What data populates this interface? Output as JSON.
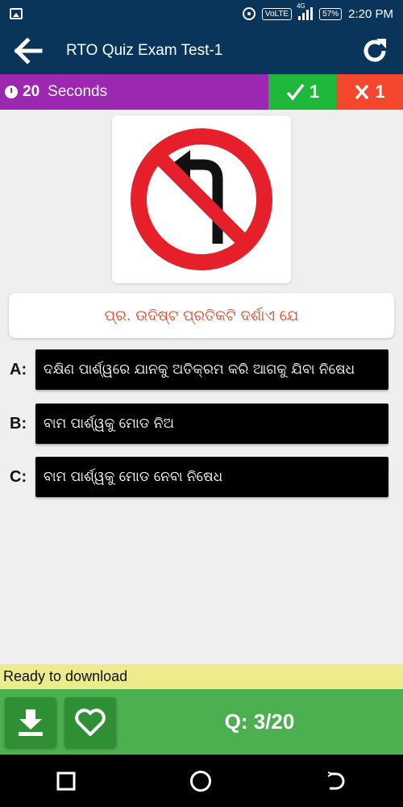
{
  "status_bar": {
    "volte": "VoLTE",
    "network": "4G",
    "battery": "57%",
    "time": "2:20 PM"
  },
  "app_bar": {
    "title": "RTO Quiz Exam Test-1",
    "back_icon": "arrow-left-icon",
    "refresh_icon": "refresh-icon"
  },
  "score": {
    "seconds": "20",
    "seconds_label": "Seconds",
    "correct": "1",
    "wrong": "1",
    "colors": {
      "timer": "#9c27b0",
      "correct": "#1fb83a",
      "wrong": "#f4472e"
    }
  },
  "question": {
    "sign_icon": "no-left-turn-sign-icon",
    "text": "ପ୍ର. ଉଦିଷ୍ଟ ପ୍ରତିକଟି ଦର୍ଶାଏ ଯେ"
  },
  "options": [
    {
      "letter": "A:",
      "text": "ଦକ୍ଷିଣ ପାର୍ଶ୍ୱରେ ଯାନକୁ ଅତିକ୍ରମ କରି ଆଗକୁ ଯିବା ନିଷେଧ"
    },
    {
      "letter": "B:",
      "text": "ବାମ ପାର୍ଶ୍ୱକୁ ମୋଡ ନିଅ"
    },
    {
      "letter": "C:",
      "text": "ବାମ ପାର୍ଶ୍ୱକୁ ମୋଡ ନେବା ନିଷେଧ"
    }
  ],
  "download": {
    "text": "Ready to download"
  },
  "bottom": {
    "counter": "Q: 3/20",
    "download_icon": "download-icon",
    "favorite_icon": "heart-icon"
  },
  "nav": {
    "recents_icon": "square-icon",
    "home_icon": "circle-icon",
    "back_icon": "back-arc-icon"
  }
}
